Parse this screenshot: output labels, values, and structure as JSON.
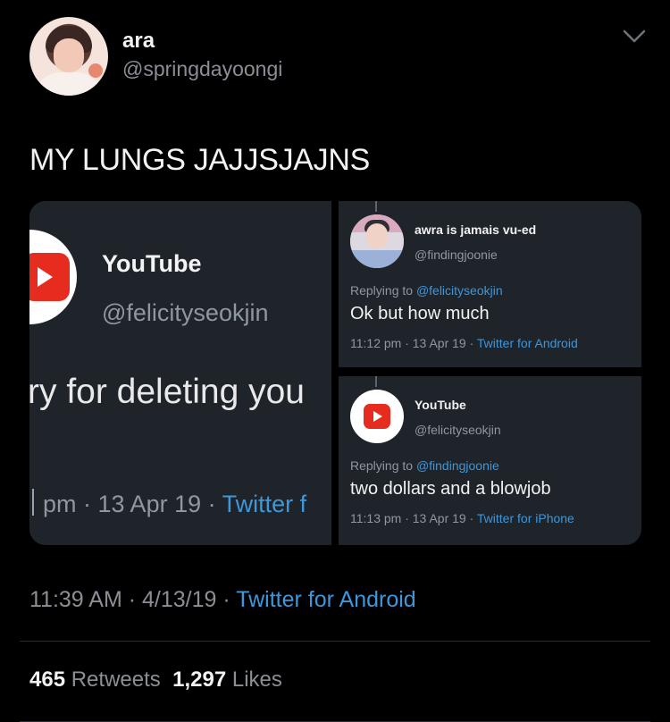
{
  "author": {
    "name": "ara",
    "handle": "@springdayoongi"
  },
  "tweet": {
    "text": "MY LUNGS JAJJSJAJNS",
    "time": "11:39 AM",
    "date": "4/13/19",
    "source": "Twitter for Android",
    "separator": "·"
  },
  "stats": {
    "retweets_count": "465",
    "retweets_label": "Retweets",
    "likes_count": "1,297",
    "likes_label": "Likes"
  },
  "media": {
    "zoomed": {
      "name": "YouTube",
      "handle": "@felicityseokjin",
      "body": "ry for deleting you",
      "meta_time": "pm · 13 Apr 19 · ",
      "meta_source": "Twitter f"
    },
    "reply1": {
      "name": "awra is jamais vu-ed",
      "handle": "@findingjoonie",
      "replying_prefix": "Replying to ",
      "replying_to": "@felicityseokjin",
      "body": "Ok but how much",
      "meta": "11:12 pm · 13 Apr 19 · ",
      "source": "Twitter for Android"
    },
    "reply2": {
      "name": "YouTube",
      "handle": "@felicityseokjin",
      "replying_prefix": "Replying to ",
      "replying_to": "@findingjoonie",
      "body": "two dollars and a blowjob",
      "meta": "11:13 pm · 13 Apr 19 · ",
      "source": "Twitter for iPhone"
    }
  },
  "icons": {
    "chevron": "chevron-down-icon",
    "youtube": "youtube-logo-icon"
  },
  "colors": {
    "background": "#000000",
    "link": "#3e96db",
    "muted": "#8b8f95",
    "youtube_red": "#e62b1f"
  }
}
